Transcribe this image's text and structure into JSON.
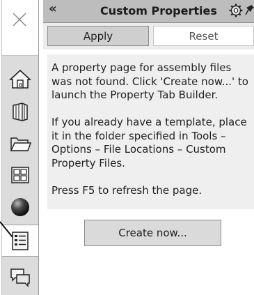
{
  "panel": {
    "title": "Custom Properties",
    "collapse_glyph": "«",
    "icons": [
      "gear-icon",
      "pin-icon"
    ]
  },
  "actions": {
    "apply_label": "Apply",
    "reset_label": "Reset"
  },
  "message": {
    "line1": "A property page for assembly files was not found. Click 'Create now...' to launch the Property Tab Builder.",
    "line2": "If you already have a template, place it in the folder specified in Tools – Options – File Locations – Custom Property Files.",
    "line3": "Press F5 to refresh the page."
  },
  "create_button_label": "Create now...",
  "sidebar": {
    "items": [
      "home-icon",
      "library-icon",
      "folder-icon",
      "view-palette-icon",
      "appearances-icon",
      "custom-properties-icon",
      "forum-icon"
    ],
    "active_item": "custom-properties-icon"
  },
  "colors": {
    "header": "#bdbdbd",
    "strip": "#dcdcdc",
    "info_bg": "#efefef",
    "create_button": "#dadada"
  }
}
